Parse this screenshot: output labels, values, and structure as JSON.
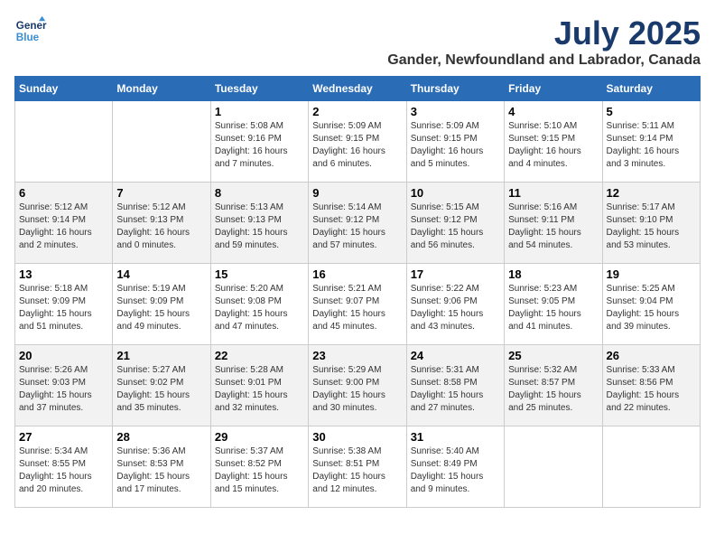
{
  "logo": {
    "line1": "General",
    "line2": "Blue"
  },
  "title": "July 2025",
  "location": "Gander, Newfoundland and Labrador, Canada",
  "days_of_week": [
    "Sunday",
    "Monday",
    "Tuesday",
    "Wednesday",
    "Thursday",
    "Friday",
    "Saturday"
  ],
  "weeks": [
    [
      {
        "day": "",
        "info": ""
      },
      {
        "day": "",
        "info": ""
      },
      {
        "day": "1",
        "info": "Sunrise: 5:08 AM\nSunset: 9:16 PM\nDaylight: 16 hours and 7 minutes."
      },
      {
        "day": "2",
        "info": "Sunrise: 5:09 AM\nSunset: 9:15 PM\nDaylight: 16 hours and 6 minutes."
      },
      {
        "day": "3",
        "info": "Sunrise: 5:09 AM\nSunset: 9:15 PM\nDaylight: 16 hours and 5 minutes."
      },
      {
        "day": "4",
        "info": "Sunrise: 5:10 AM\nSunset: 9:15 PM\nDaylight: 16 hours and 4 minutes."
      },
      {
        "day": "5",
        "info": "Sunrise: 5:11 AM\nSunset: 9:14 PM\nDaylight: 16 hours and 3 minutes."
      }
    ],
    [
      {
        "day": "6",
        "info": "Sunrise: 5:12 AM\nSunset: 9:14 PM\nDaylight: 16 hours and 2 minutes."
      },
      {
        "day": "7",
        "info": "Sunrise: 5:12 AM\nSunset: 9:13 PM\nDaylight: 16 hours and 0 minutes."
      },
      {
        "day": "8",
        "info": "Sunrise: 5:13 AM\nSunset: 9:13 PM\nDaylight: 15 hours and 59 minutes."
      },
      {
        "day": "9",
        "info": "Sunrise: 5:14 AM\nSunset: 9:12 PM\nDaylight: 15 hours and 57 minutes."
      },
      {
        "day": "10",
        "info": "Sunrise: 5:15 AM\nSunset: 9:12 PM\nDaylight: 15 hours and 56 minutes."
      },
      {
        "day": "11",
        "info": "Sunrise: 5:16 AM\nSunset: 9:11 PM\nDaylight: 15 hours and 54 minutes."
      },
      {
        "day": "12",
        "info": "Sunrise: 5:17 AM\nSunset: 9:10 PM\nDaylight: 15 hours and 53 minutes."
      }
    ],
    [
      {
        "day": "13",
        "info": "Sunrise: 5:18 AM\nSunset: 9:09 PM\nDaylight: 15 hours and 51 minutes."
      },
      {
        "day": "14",
        "info": "Sunrise: 5:19 AM\nSunset: 9:09 PM\nDaylight: 15 hours and 49 minutes."
      },
      {
        "day": "15",
        "info": "Sunrise: 5:20 AM\nSunset: 9:08 PM\nDaylight: 15 hours and 47 minutes."
      },
      {
        "day": "16",
        "info": "Sunrise: 5:21 AM\nSunset: 9:07 PM\nDaylight: 15 hours and 45 minutes."
      },
      {
        "day": "17",
        "info": "Sunrise: 5:22 AM\nSunset: 9:06 PM\nDaylight: 15 hours and 43 minutes."
      },
      {
        "day": "18",
        "info": "Sunrise: 5:23 AM\nSunset: 9:05 PM\nDaylight: 15 hours and 41 minutes."
      },
      {
        "day": "19",
        "info": "Sunrise: 5:25 AM\nSunset: 9:04 PM\nDaylight: 15 hours and 39 minutes."
      }
    ],
    [
      {
        "day": "20",
        "info": "Sunrise: 5:26 AM\nSunset: 9:03 PM\nDaylight: 15 hours and 37 minutes."
      },
      {
        "day": "21",
        "info": "Sunrise: 5:27 AM\nSunset: 9:02 PM\nDaylight: 15 hours and 35 minutes."
      },
      {
        "day": "22",
        "info": "Sunrise: 5:28 AM\nSunset: 9:01 PM\nDaylight: 15 hours and 32 minutes."
      },
      {
        "day": "23",
        "info": "Sunrise: 5:29 AM\nSunset: 9:00 PM\nDaylight: 15 hours and 30 minutes."
      },
      {
        "day": "24",
        "info": "Sunrise: 5:31 AM\nSunset: 8:58 PM\nDaylight: 15 hours and 27 minutes."
      },
      {
        "day": "25",
        "info": "Sunrise: 5:32 AM\nSunset: 8:57 PM\nDaylight: 15 hours and 25 minutes."
      },
      {
        "day": "26",
        "info": "Sunrise: 5:33 AM\nSunset: 8:56 PM\nDaylight: 15 hours and 22 minutes."
      }
    ],
    [
      {
        "day": "27",
        "info": "Sunrise: 5:34 AM\nSunset: 8:55 PM\nDaylight: 15 hours and 20 minutes."
      },
      {
        "day": "28",
        "info": "Sunrise: 5:36 AM\nSunset: 8:53 PM\nDaylight: 15 hours and 17 minutes."
      },
      {
        "day": "29",
        "info": "Sunrise: 5:37 AM\nSunset: 8:52 PM\nDaylight: 15 hours and 15 minutes."
      },
      {
        "day": "30",
        "info": "Sunrise: 5:38 AM\nSunset: 8:51 PM\nDaylight: 15 hours and 12 minutes."
      },
      {
        "day": "31",
        "info": "Sunrise: 5:40 AM\nSunset: 8:49 PM\nDaylight: 15 hours and 9 minutes."
      },
      {
        "day": "",
        "info": ""
      },
      {
        "day": "",
        "info": ""
      }
    ]
  ]
}
